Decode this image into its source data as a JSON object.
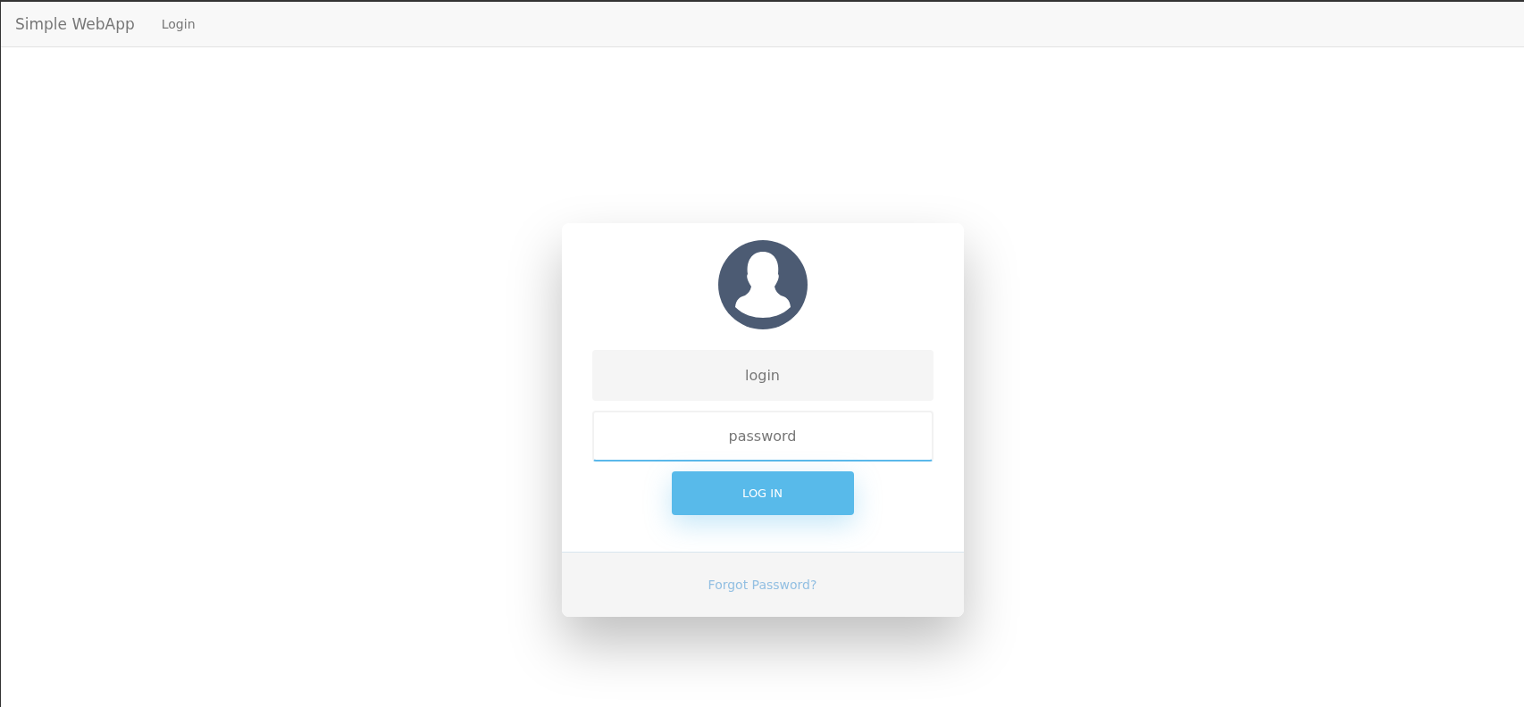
{
  "navbar": {
    "brand": "Simple WebApp",
    "links": [
      {
        "label": "Login",
        "selected": false
      }
    ]
  },
  "login_card": {
    "fields": [
      {
        "placeholder": "login",
        "focused": false
      },
      {
        "placeholder": "password",
        "focused": true
      }
    ],
    "button": "LOG IN",
    "footer_link": "Forgot Password?"
  }
}
